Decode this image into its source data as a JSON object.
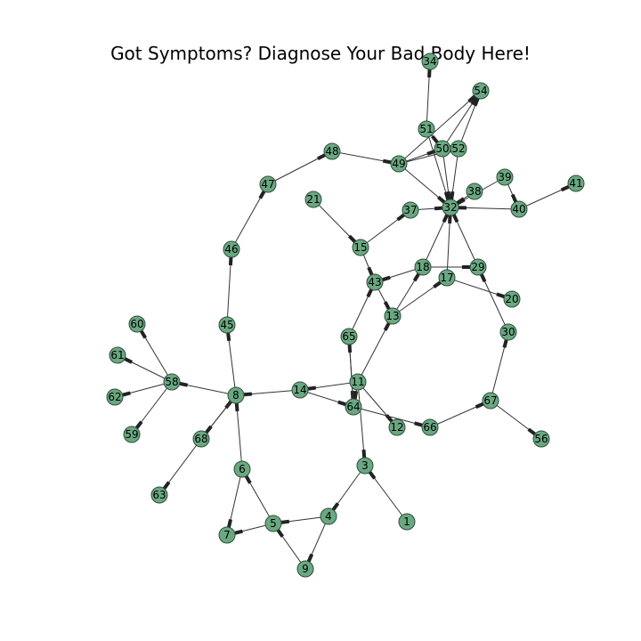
{
  "title": "Got Symptoms? Diagnose Your Bad Body Here!",
  "colors": {
    "node_fill": "#6aa882",
    "node_stroke": "#2f4f3a",
    "edge": "#333333",
    "arrow": "#222222"
  },
  "nodes": [
    "1",
    "3",
    "4",
    "5",
    "6",
    "7",
    "8",
    "9",
    "11",
    "12",
    "13",
    "14",
    "15",
    "17",
    "18",
    "20",
    "21",
    "29",
    "30",
    "32",
    "34",
    "37",
    "38",
    "39",
    "40",
    "41",
    "43",
    "45",
    "46",
    "47",
    "48",
    "49",
    "50",
    "51",
    "52",
    "54",
    "56",
    "58",
    "59",
    "60",
    "61",
    "62",
    "63",
    "64",
    "65",
    "66",
    "67",
    "68"
  ],
  "edges": [
    [
      "1",
      "3"
    ],
    [
      "3",
      "4"
    ],
    [
      "4",
      "5"
    ],
    [
      "4",
      "9"
    ],
    [
      "9",
      "5"
    ],
    [
      "5",
      "6"
    ],
    [
      "5",
      "7"
    ],
    [
      "6",
      "7"
    ],
    [
      "6",
      "8"
    ],
    [
      "68",
      "8"
    ],
    [
      "8",
      "68"
    ],
    [
      "68",
      "63"
    ],
    [
      "14",
      "8"
    ],
    [
      "8",
      "58"
    ],
    [
      "58",
      "60"
    ],
    [
      "58",
      "61"
    ],
    [
      "58",
      "62"
    ],
    [
      "58",
      "59"
    ],
    [
      "8",
      "45"
    ],
    [
      "45",
      "46"
    ],
    [
      "46",
      "47"
    ],
    [
      "47",
      "48"
    ],
    [
      "48",
      "49"
    ],
    [
      "49",
      "50"
    ],
    [
      "49",
      "52"
    ],
    [
      "49",
      "54"
    ],
    [
      "49",
      "32"
    ],
    [
      "51",
      "34"
    ],
    [
      "51",
      "50"
    ],
    [
      "51",
      "32"
    ],
    [
      "50",
      "54"
    ],
    [
      "50",
      "32"
    ],
    [
      "52",
      "32"
    ],
    [
      "52",
      "54"
    ],
    [
      "38",
      "32"
    ],
    [
      "39",
      "32"
    ],
    [
      "39",
      "40"
    ],
    [
      "40",
      "41"
    ],
    [
      "40",
      "32"
    ],
    [
      "37",
      "32"
    ],
    [
      "15",
      "37"
    ],
    [
      "21",
      "15"
    ],
    [
      "15",
      "43"
    ],
    [
      "18",
      "43"
    ],
    [
      "18",
      "29"
    ],
    [
      "18",
      "32"
    ],
    [
      "17",
      "32"
    ],
    [
      "17",
      "20"
    ],
    [
      "13",
      "17"
    ],
    [
      "13",
      "18"
    ],
    [
      "43",
      "13"
    ],
    [
      "11",
      "13"
    ],
    [
      "11",
      "14"
    ],
    [
      "11",
      "12"
    ],
    [
      "11",
      "3"
    ],
    [
      "11",
      "64"
    ],
    [
      "14",
      "64"
    ],
    [
      "65",
      "64"
    ],
    [
      "64",
      "65"
    ],
    [
      "65",
      "43"
    ],
    [
      "64",
      "66"
    ],
    [
      "66",
      "67"
    ],
    [
      "67",
      "56"
    ],
    [
      "67",
      "30"
    ],
    [
      "30",
      "29"
    ],
    [
      "29",
      "32"
    ]
  ]
}
